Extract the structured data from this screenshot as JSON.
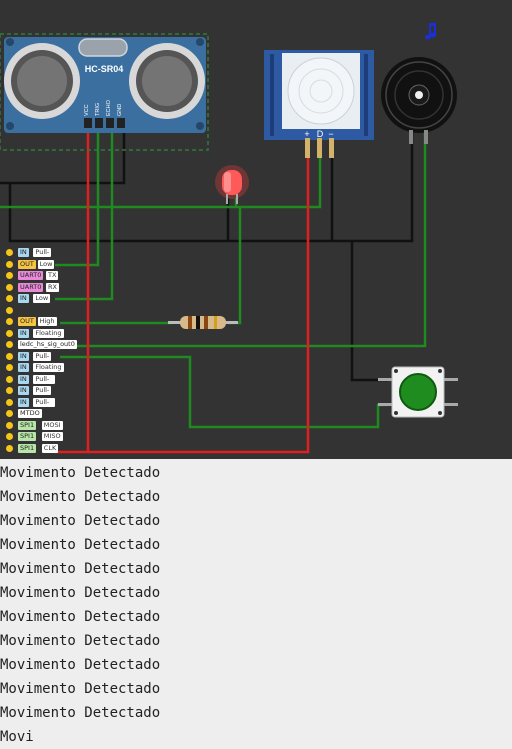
{
  "sensor": {
    "ultrasonic_label": "HC-SR04",
    "ultrasonic_pins": [
      "VCC",
      "TRIG",
      "ECHO",
      "GND"
    ],
    "pir_pins": [
      "+",
      "D",
      "−"
    ]
  },
  "buzzer": {
    "note_icon": "music-note-icon"
  },
  "pins": [
    {
      "type": "in",
      "badge": "IN",
      "value": "Pull-up"
    },
    {
      "type": "out",
      "badge": "OUT",
      "value": "Low"
    },
    {
      "type": "uart",
      "badge": "UART0",
      "value": "TX"
    },
    {
      "type": "uart",
      "badge": "UART0",
      "value": "RX"
    },
    {
      "type": "in",
      "badge": "IN",
      "value": "Low"
    },
    {
      "type": "blank",
      "badge": "",
      "value": ""
    },
    {
      "type": "out",
      "badge": "OUT",
      "value": "High"
    },
    {
      "type": "in",
      "badge": "IN",
      "value": "Floating"
    },
    {
      "type": "plain",
      "badge": "ledc_hs_sig_out0",
      "value": ""
    },
    {
      "type": "in",
      "badge": "IN",
      "value": "Pull-up"
    },
    {
      "type": "in",
      "badge": "IN",
      "value": "Floating"
    },
    {
      "type": "in",
      "badge": "IN",
      "value": "Pull-down"
    },
    {
      "type": "in",
      "badge": "IN",
      "value": "Pull-up"
    },
    {
      "type": "in",
      "badge": "IN",
      "value": "Pull-down"
    },
    {
      "type": "plain",
      "badge": "MTDO",
      "value": ""
    },
    {
      "type": "spi",
      "badge": "SPI1",
      "value": "MOSI"
    },
    {
      "type": "spi",
      "badge": "SPI1",
      "value": "MISO"
    },
    {
      "type": "spi",
      "badge": "SPI1",
      "value": "CLK"
    }
  ],
  "console": {
    "lines": [
      "Movimento Detectado",
      "Movimento Detectado",
      "Movimento Detectado",
      "Movimento Detectado",
      "Movimento Detectado",
      "Movimento Detectado",
      "Movimento Detectado",
      "Movimento Detectado",
      "Movimento Detectado",
      "Movimento Detectado",
      "Movimento Detectado",
      "Movi"
    ]
  },
  "colors": {
    "wire_green": "#1f8a1f",
    "wire_red": "#e02020",
    "wire_black": "#111111",
    "led_red": "#ff3b3b",
    "button_green": "#1e8c1e"
  }
}
